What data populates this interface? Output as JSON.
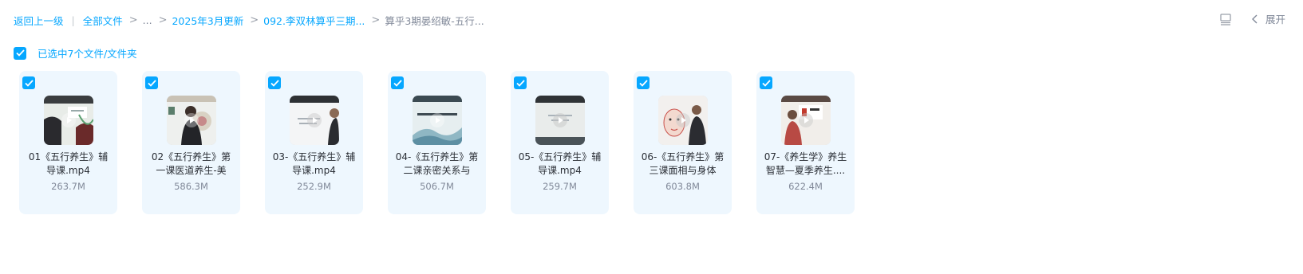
{
  "breadcrumb": {
    "back": "返回上一级",
    "all_files": "全部文件",
    "ellipsis": "...",
    "level1": "2025年3月更新",
    "level2": "092.李双林算乎三期...",
    "current": "算乎3期晏绍敏-五行..."
  },
  "toolbar": {
    "expand_label": "展开"
  },
  "selection": {
    "text": "已选中7个文件/文件夹",
    "checked": true
  },
  "colors": {
    "accent": "#06a7ff",
    "card_bg": "#eef7fe",
    "muted": "#818999"
  },
  "files": [
    {
      "name": "01《五行养生》辅导课.mp4",
      "size": "263.7M",
      "checked": true,
      "icon": "video-thumbnail"
    },
    {
      "name": "02《五行养生》第一课医道养生-美",
      "size": "586.3M",
      "checked": true,
      "icon": "video-thumbnail"
    },
    {
      "name": "03-《五行养生》辅导课.mp4",
      "size": "252.9M",
      "checked": true,
      "icon": "video-thumbnail"
    },
    {
      "name": "04-《五行养生》第二课亲密关系与",
      "size": "506.7M",
      "checked": true,
      "icon": "video-thumbnail"
    },
    {
      "name": "05-《五行养生》辅导课.mp4",
      "size": "259.7M",
      "checked": true,
      "icon": "video-thumbnail"
    },
    {
      "name": "06-《五行养生》第三课面相与身体",
      "size": "603.8M",
      "checked": true,
      "icon": "video-thumbnail"
    },
    {
      "name": "07-《养生学》养生智慧—夏季养生....",
      "size": "622.4M",
      "checked": true,
      "icon": "video-thumbnail"
    }
  ]
}
